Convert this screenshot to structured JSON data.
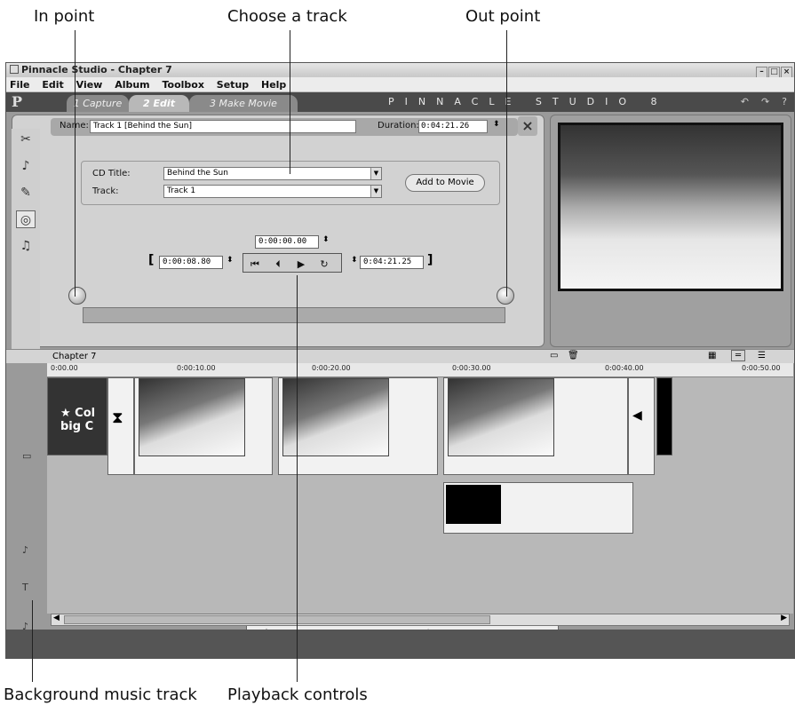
{
  "callouts": {
    "in_point": "In point",
    "choose_track": "Choose a track",
    "out_point": "Out point",
    "background_music": "Background music track",
    "playback_controls": "Playback controls"
  },
  "window": {
    "title": "Pinnacle Studio - Chapter 7",
    "menu": [
      "File",
      "Edit",
      "View",
      "Album",
      "Toolbox",
      "Setup",
      "Help"
    ],
    "tabs": [
      "1 Capture",
      "2 Edit",
      "3 Make Movie"
    ],
    "brand": "PINNACLE STUDIO 8"
  },
  "editor": {
    "name_label": "Name:",
    "name_value": "Track 1 [Behind the Sun]",
    "duration_label": "Duration:",
    "duration_value": "0:04:21.26",
    "cd_title_label": "CD Title:",
    "cd_title_value": "Behind the Sun",
    "track_label": "Track:",
    "track_value": "Track 1",
    "add_button": "Add to Movie",
    "current_time": "0:00:00.00",
    "in_time": "0:00:08.80",
    "out_time": "0:04:21.25"
  },
  "timeline": {
    "title": "Chapter 7",
    "ticks": [
      "0:00.00",
      "0:00:10.00",
      "0:00:20.00",
      "0:00:30.00",
      "0:00:40.00",
      "0:00:50.00"
    ],
    "title_clip_text": "★ Col big C"
  }
}
